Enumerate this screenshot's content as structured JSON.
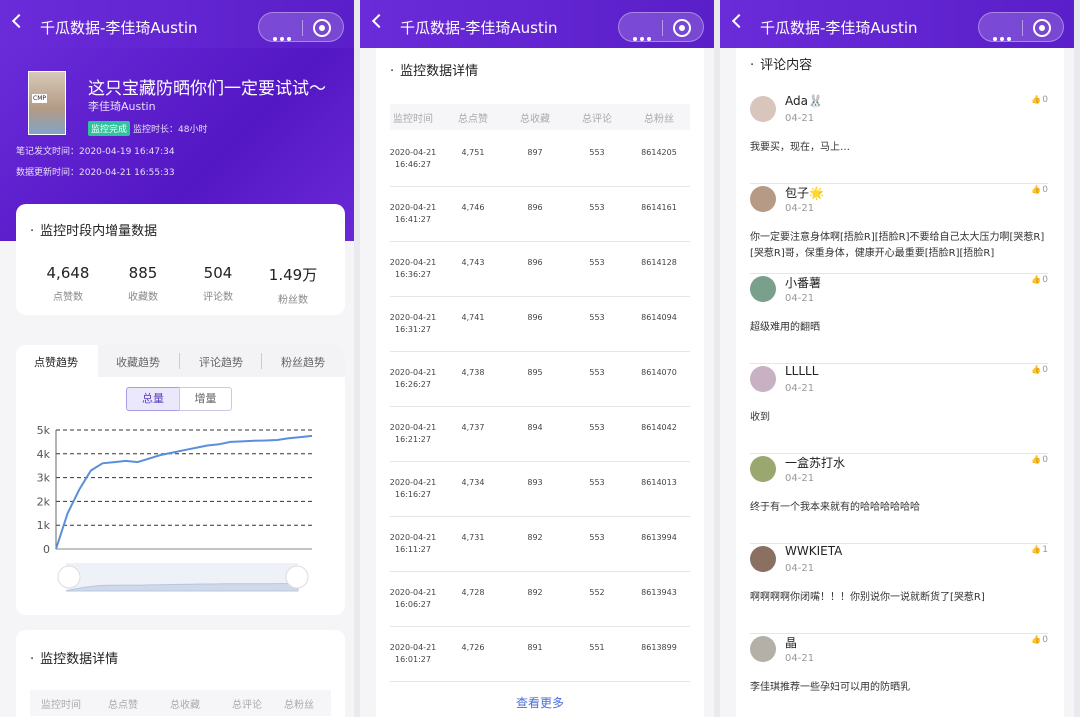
{
  "app_title": "千瓜数据-李佳琦Austin",
  "note": {
    "title": "这只宝藏防晒你们一定要试试～",
    "author": "李佳琦Austin",
    "status_badge": "监控完成",
    "duration": "监控时长：48小时",
    "publish_time": "笔记发文时间：2020-04-19 16:47:34",
    "update_time": "数据更新时间：2020-04-21 16:55:33",
    "thumb_text": "CMP"
  },
  "increase": {
    "title": "监控时段内增量数据",
    "stats": [
      {
        "value": "4,648",
        "label": "点赞数"
      },
      {
        "value": "885",
        "label": "收藏数"
      },
      {
        "value": "504",
        "label": "评论数"
      },
      {
        "value": "1.49万",
        "label": "粉丝数"
      }
    ]
  },
  "trend": {
    "tabs": [
      "点赞趋势",
      "收藏趋势",
      "评论趋势",
      "粉丝趋势"
    ],
    "segments": [
      "总量",
      "增量"
    ]
  },
  "chart_data": {
    "type": "line",
    "title": "",
    "ylim": [
      0,
      5000
    ],
    "yticks": [
      "0",
      "1k",
      "2k",
      "3k",
      "4k",
      "5k"
    ],
    "series": [
      {
        "values": [
          0,
          1500,
          2500,
          3300,
          3600,
          3650,
          3700,
          3650,
          3800,
          3950,
          4050,
          4150,
          4250,
          4350,
          4400,
          4500,
          4520,
          4550,
          4560,
          4580,
          4650,
          4700,
          4751
        ]
      }
    ]
  },
  "detail": {
    "title": "监控数据详情",
    "headers": [
      "监控时间",
      "总点赞",
      "总收藏",
      "总评论",
      "总粉丝"
    ],
    "rows": [
      {
        "date": "2020-04-21",
        "time": "16:46:27",
        "likes": "4,751",
        "favs": "897",
        "comments": "553",
        "fans": "8614205"
      },
      {
        "date": "2020-04-21",
        "time": "16:41:27",
        "likes": "4,746",
        "favs": "896",
        "comments": "553",
        "fans": "8614161"
      },
      {
        "date": "2020-04-21",
        "time": "16:36:27",
        "likes": "4,743",
        "favs": "896",
        "comments": "553",
        "fans": "8614128"
      },
      {
        "date": "2020-04-21",
        "time": "16:31:27",
        "likes": "4,741",
        "favs": "896",
        "comments": "553",
        "fans": "8614094"
      },
      {
        "date": "2020-04-21",
        "time": "16:26:27",
        "likes": "4,738",
        "favs": "895",
        "comments": "553",
        "fans": "8614070"
      },
      {
        "date": "2020-04-21",
        "time": "16:21:27",
        "likes": "4,737",
        "favs": "894",
        "comments": "553",
        "fans": "8614042"
      },
      {
        "date": "2020-04-21",
        "time": "16:16:27",
        "likes": "4,734",
        "favs": "893",
        "comments": "553",
        "fans": "8614013"
      },
      {
        "date": "2020-04-21",
        "time": "16:11:27",
        "likes": "4,731",
        "favs": "892",
        "comments": "553",
        "fans": "8613994"
      },
      {
        "date": "2020-04-21",
        "time": "16:06:27",
        "likes": "4,728",
        "favs": "892",
        "comments": "552",
        "fans": "8613943"
      },
      {
        "date": "2020-04-21",
        "time": "16:01:27",
        "likes": "4,726",
        "favs": "891",
        "comments": "551",
        "fans": "8613899"
      }
    ],
    "more": "查看更多"
  },
  "comments": {
    "title": "评论内容",
    "items": [
      {
        "name": "Ada🐰",
        "date": "04-21",
        "likes": "0",
        "text": "我要买，现在，马上…",
        "color": "#d8c5bb"
      },
      {
        "name": "包子🌟",
        "date": "04-21",
        "likes": "0",
        "text": "你一定要注意身体啊[捂脸R][捂脸R]不要给自己太大压力啊[哭惹R][哭惹R]哥，保重身体，健康开心最重要[捂脸R][捂脸R]",
        "color": "#b79a86"
      },
      {
        "name": "小番薯",
        "date": "04-21",
        "likes": "0",
        "text": "超级难用的翻晒",
        "color": "#7aa08c"
      },
      {
        "name": "LLLLL",
        "date": "04-21",
        "likes": "0",
        "text": "收到",
        "color": "#c8b1c2"
      },
      {
        "name": "一盒苏打水",
        "date": "04-21",
        "likes": "0",
        "text": "终于有一个我本来就有的哈哈哈哈哈哈",
        "color": "#9aa870"
      },
      {
        "name": "WWKIETA",
        "date": "04-21",
        "likes": "1",
        "text": "啊啊啊啊你闭嘴！！！你别说你一说就断货了[哭惹R]",
        "color": "#8a7060"
      },
      {
        "name": "晶",
        "date": "04-21",
        "likes": "0",
        "text": "李佳琪推荐一些孕妇可以用的防晒乳",
        "color": "#b4b0a8"
      }
    ]
  }
}
